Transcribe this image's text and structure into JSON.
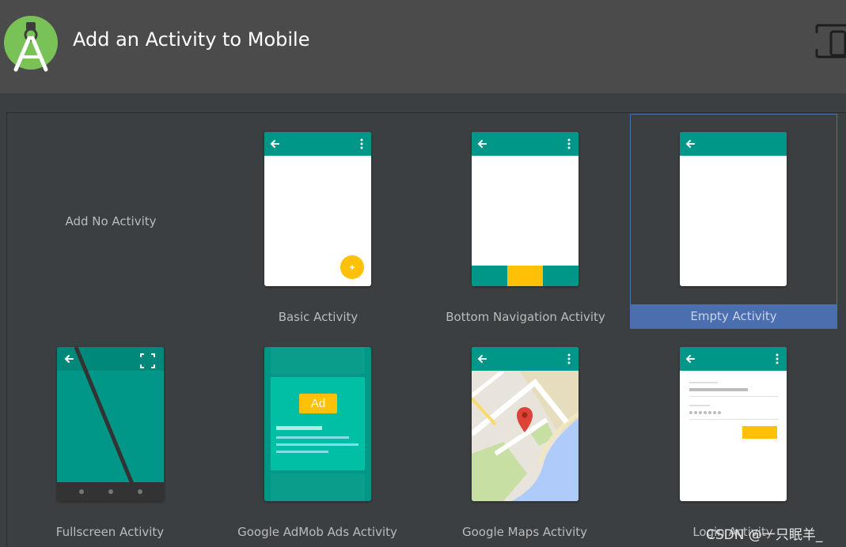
{
  "window": {
    "title": "Add an Activity to Mobile"
  },
  "icons": {
    "logo": "android-studio-logo-icon",
    "device": "device-icon"
  },
  "colors": {
    "teal": "#009688",
    "amber": "#ffc107",
    "selection": "#4b6eaf",
    "background": "#3c3f41",
    "header": "#4b4b4b"
  },
  "templates": [
    {
      "label": "Add No Activity",
      "selected": false
    },
    {
      "label": "Basic Activity",
      "selected": false
    },
    {
      "label": "Bottom Navigation Activity",
      "selected": false
    },
    {
      "label": "Empty Activity",
      "selected": true
    },
    {
      "label": "Fullscreen Activity",
      "selected": false
    },
    {
      "label": "Google AdMob Ads Activity",
      "selected": false,
      "ad_badge": "Ad"
    },
    {
      "label": "Google Maps Activity",
      "selected": false
    },
    {
      "label": "Login Activity",
      "selected": false
    }
  ],
  "watermark": "CSDN @一只眠羊_"
}
